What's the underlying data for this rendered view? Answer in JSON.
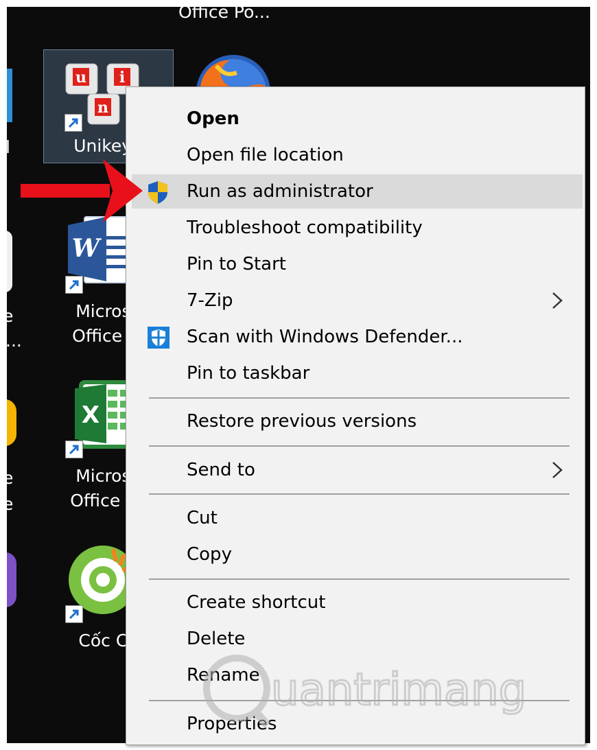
{
  "desktop": {
    "top_label": "Office Po...",
    "left_edge_labels": [
      "l",
      "e",
      "...",
      "e",
      "e"
    ],
    "icons": [
      {
        "label_lines": [
          "UnikeyN"
        ],
        "icon": "unikey-keyboard-icon"
      },
      {
        "label_lines": [],
        "icon": "firefox-icon"
      },
      {
        "label_lines": [
          "Microso",
          "Office W"
        ],
        "icon": "word-icon"
      },
      {
        "label_lines": [
          "Microso",
          "Office Ex"
        ],
        "icon": "excel-icon"
      },
      {
        "label_lines": [
          "Cốc Cô"
        ],
        "icon": "coccoc-icon"
      }
    ],
    "unikey_keys": [
      "u",
      "i",
      "n"
    ]
  },
  "context_menu": {
    "groups": [
      [
        {
          "label": "Open",
          "bold": true
        },
        {
          "label": "Open file location"
        },
        {
          "label": "Run as administrator",
          "icon": "uac-shield-icon",
          "highlighted": true
        },
        {
          "label": "Troubleshoot compatibility"
        },
        {
          "label": "Pin to Start"
        },
        {
          "label": "7-Zip",
          "submenu": true
        },
        {
          "label": "Scan with Windows Defender...",
          "icon": "windows-defender-icon"
        },
        {
          "label": "Pin to taskbar"
        }
      ],
      [
        {
          "label": "Restore previous versions"
        }
      ],
      [
        {
          "label": "Send to",
          "submenu": true
        }
      ],
      [
        {
          "label": "Cut"
        },
        {
          "label": "Copy"
        }
      ],
      [
        {
          "label": "Create shortcut"
        },
        {
          "label": "Delete"
        },
        {
          "label": "Rename"
        }
      ],
      [
        {
          "label": "Properties"
        }
      ]
    ]
  },
  "annotation": {
    "arrow_color": "#e8101a"
  },
  "watermark": {
    "text": "uantrimang",
    "color": "#b0b0b0"
  }
}
